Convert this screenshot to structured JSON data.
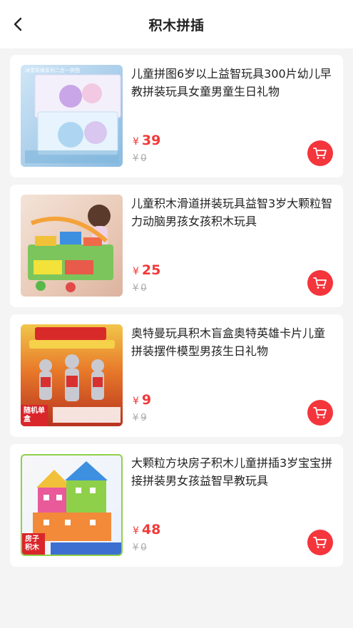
{
  "header": {
    "title": "积木拼插",
    "back_icon": "chevron-left-icon"
  },
  "products": [
    {
      "name": "儿童拼图6岁以上益智玩具300片幼儿早教拼装玩具女童男童生日礼物",
      "currency": "¥",
      "price": "39",
      "orig_price": "0",
      "image_text": "冰雪奇缘系列二合一拼图"
    },
    {
      "name": "儿童积木滑道拼装玩具益智3岁大颗粒智力动脑男孩女孩积木玩具",
      "currency": "¥",
      "price": "25",
      "orig_price": "0"
    },
    {
      "name": "奥特曼玩具积木盲盒奥特英雄卡片儿童拼装摆件模型男孩生日礼物",
      "currency": "¥",
      "price": "9",
      "orig_price": "9",
      "image_tag": "随机单盒"
    },
    {
      "name": "大颗粒方块房子积木儿童拼插3岁宝宝拼接拼装男女孩益智早教玩具",
      "currency": "¥",
      "price": "48",
      "orig_price": "0",
      "image_tag": "房子积木"
    }
  ],
  "colors": {
    "accent": "#f4353b",
    "price": "#f23a3a",
    "background": "#f4f4f4"
  }
}
